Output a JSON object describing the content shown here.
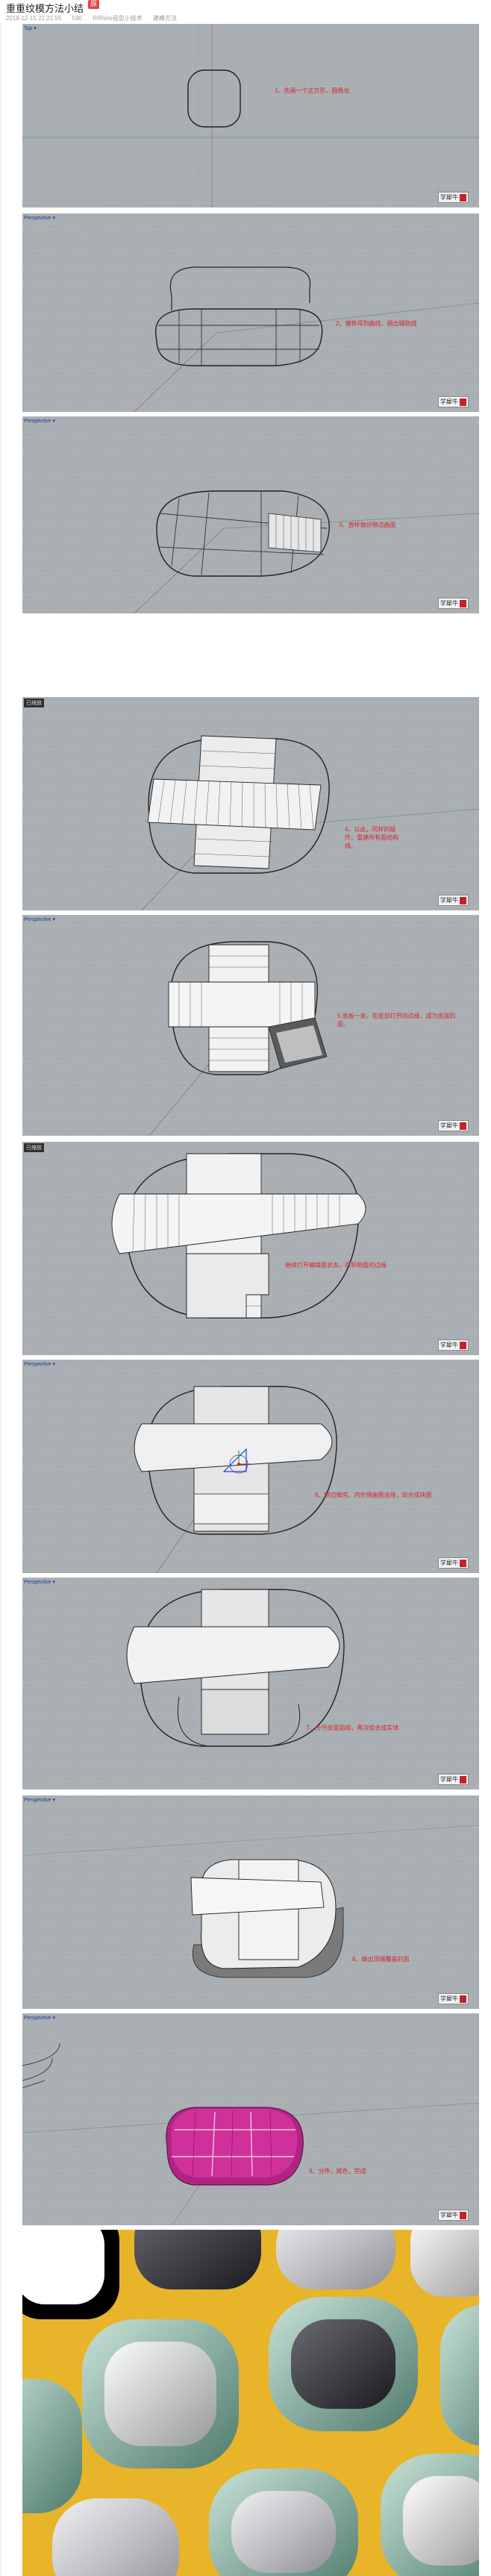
{
  "header": {
    "title": "重重纹模方法小结",
    "badge": "原",
    "meta": [
      "2018-12-15 21:21:55",
      "590",
      "RRhino造型小技术",
      "建模方法"
    ]
  },
  "panels": [
    {
      "label": "Top ▾",
      "note": "1、先画一个正方形，圆角化"
    },
    {
      "label": "Perspective ▾",
      "note": "2、偏移得到曲线，画出辅助线"
    },
    {
      "label": "Perspective ▾",
      "note": "3、放样做好侧边曲面"
    },
    {
      "label": "已缩放",
      "note": "4、以此，同样的操作，重建所有面结构线。"
    },
    {
      "label": "Perspective ▾",
      "note": "5.底板一条，在底部打开的边缘，成为底面的面。"
    },
    {
      "label": "已缩放",
      "note": "继续打开编辑面状态，得到侧面的边缘"
    },
    {
      "label": "Perspective ▾",
      "note": "6、侧边做完，内外侧曲面连接，组合成块面"
    },
    {
      "label": "Perspective ▾",
      "note": "7、分开底面面组，再次组合成实体"
    },
    {
      "label": "Perspective ▾",
      "note": "8、做出顶端覆盖的面"
    },
    {
      "label": "Perspective ▾",
      "note": "9、分件，赋色，完成"
    }
  ],
  "logo_text": "学犀牛",
  "colors": {
    "viewport_bg": "#a9aeb3",
    "grid": "#b8bdc2",
    "note": "#d8262d",
    "magenta": "#d0309a",
    "render_yellow": "#e8b42a",
    "render_teal": "#7aa89a"
  }
}
